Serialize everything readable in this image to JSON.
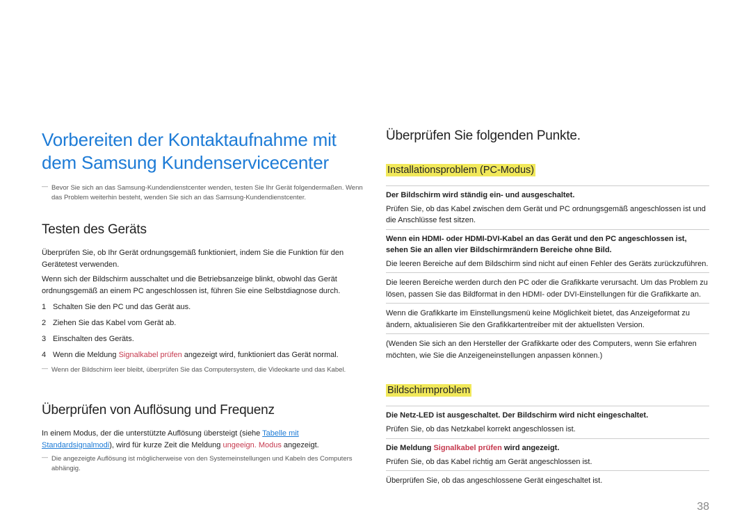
{
  "left": {
    "h1": "Vorbereiten der Kontaktaufnahme mit dem Samsung Kundenservicecenter",
    "footnote1": "Bevor Sie sich an das Samsung-Kundendienstcenter wenden, testen Sie Ihr Gerät folgendermaßen. Wenn das Problem weiterhin besteht, wenden Sie sich an das Samsung-Kundendienstcenter.",
    "sect1": {
      "h2": "Testen des Geräts",
      "p1": "Überprüfen Sie, ob Ihr Gerät ordnungsgemäß funktioniert, indem Sie die Funktion für den Gerätetest verwenden.",
      "p2": "Wenn sich der Bildschirm ausschaltet und die Betriebsanzeige blinkt, obwohl das Gerät ordnungsgemäß an einem PC angeschlossen ist, führen Sie eine Selbstdiagnose durch.",
      "li1": "Schalten Sie den PC und das Gerät aus.",
      "li2": "Ziehen Sie das Kabel vom Gerät ab.",
      "li3": "Einschalten des Geräts.",
      "li4a": "Wenn die Meldung ",
      "li4red": "Signalkabel prüfen",
      "li4b": " angezeigt wird, funktioniert das Gerät normal.",
      "footnote2": "Wenn der Bildschirm leer bleibt, überprüfen Sie das Computersystem, die Videokarte und das Kabel."
    },
    "sect2": {
      "h2": "Überprüfen von Auflösung und Frequenz",
      "p1a": "In einem Modus, der die unterstützte Auflösung übersteigt (siehe ",
      "p1link": "Tabelle mit Standardsignalmodi",
      "p1b": "), wird für kurze Zeit die Meldung ",
      "p1red": "ungeeign. Modus",
      "p1c": " angezeigt.",
      "footnote3": "Die angezeigte Auflösung ist möglicherweise von den Systemeinstellungen und Kabeln des Computers abhängig."
    }
  },
  "right": {
    "h2": "Überprüfen Sie folgenden Punkte.",
    "sect1": {
      "h3": "Installationsproblem (PC-Modus)",
      "qa": [
        {
          "q": "Der Bildschirm wird ständig ein- und ausgeschaltet.",
          "a": "Prüfen Sie, ob das Kabel zwischen dem Gerät und PC ordnungsgemäß angeschlossen ist und die Anschlüsse fest sitzen."
        },
        {
          "q": "Wenn ein HDMI- oder HDMI-DVI-Kabel an das Gerät und den PC angeschlossen ist, sehen Sie an allen vier Bildschirmrändern Bereiche ohne Bild.",
          "a": "Die leeren Bereiche auf dem Bildschirm sind nicht auf einen Fehler des Geräts zurückzuführen."
        },
        {
          "q": "",
          "a": "Die leeren Bereiche werden durch den PC oder die Grafikkarte verursacht. Um das Problem zu lösen, passen Sie das Bildformat in den HDMI- oder DVI-Einstellungen für die Grafikkarte an."
        },
        {
          "q": "",
          "a": "Wenn die Grafikkarte im Einstellungsmenü keine Möglichkeit bietet, das Anzeigeformat zu ändern, aktualisieren Sie den Grafikkartentreiber mit der aktuellsten Version."
        },
        {
          "q": "",
          "a": "(Wenden Sie sich an den Hersteller der Grafikkarte oder des Computers, wenn Sie erfahren möchten, wie Sie die Anzeigeneinstellungen anpassen können.)"
        }
      ]
    },
    "sect2": {
      "h3": "Bildschirmproblem",
      "qa": [
        {
          "q": "Die Netz-LED ist ausgeschaltet. Der Bildschirm wird nicht eingeschaltet.",
          "a": "Prüfen Sie, ob das Netzkabel korrekt angeschlossen ist."
        },
        {
          "qa": "Die Meldung ",
          "qred": "Signalkabel prüfen",
          "qb": " wird angezeigt.",
          "a": "Prüfen Sie, ob das Kabel richtig am Gerät angeschlossen ist."
        },
        {
          "q": "",
          "a": "Überprüfen Sie, ob das angeschlossene Gerät eingeschaltet ist."
        }
      ]
    }
  },
  "pagenum": "38"
}
